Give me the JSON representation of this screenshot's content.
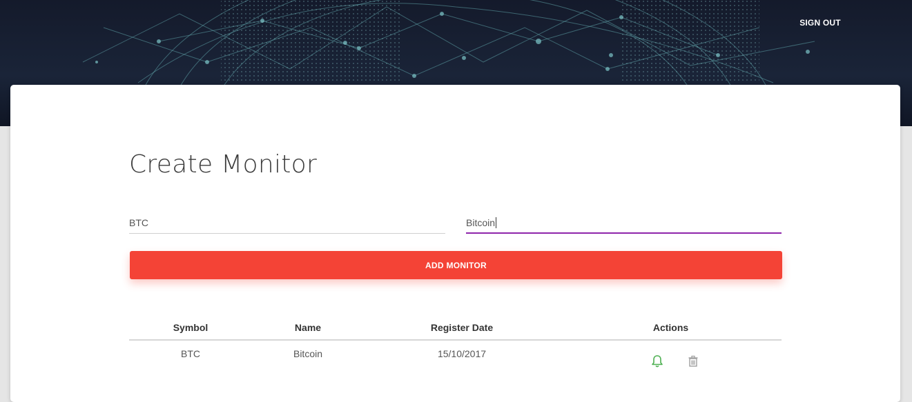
{
  "header": {
    "signout_label": "SIGN OUT"
  },
  "card": {
    "title": "Create Monitor"
  },
  "form": {
    "symbol_value": "BTC",
    "name_value": "Bitcoin",
    "add_button_label": "ADD MONITOR"
  },
  "table": {
    "columns": [
      "Symbol",
      "Name",
      "Register Date",
      "Actions"
    ],
    "rows": [
      {
        "symbol": "BTC",
        "name": "Bitcoin",
        "register_date": "15/10/2017",
        "actions": [
          "bell-icon",
          "trash-icon"
        ]
      }
    ]
  },
  "colors": {
    "header_bg": "#141a2b",
    "accent_purple": "#8e24aa",
    "button_red": "#f44336",
    "bell_green": "#4caf50",
    "trash_gray": "#9e9e9e"
  }
}
